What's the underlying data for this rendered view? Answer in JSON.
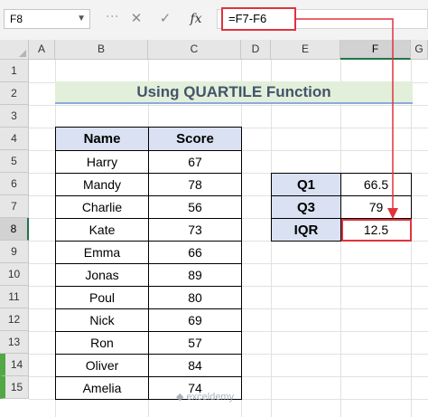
{
  "name_box": "F8",
  "formula": "=F7-F6",
  "columns": [
    "A",
    "B",
    "C",
    "D",
    "E",
    "F",
    "G"
  ],
  "rows": [
    "1",
    "2",
    "3",
    "4",
    "5",
    "6",
    "7",
    "8",
    "9",
    "10",
    "11",
    "12",
    "13",
    "14",
    "15"
  ],
  "title": "Using QUARTILE Function",
  "table": {
    "headers": [
      "Name",
      "Score"
    ],
    "rows": [
      [
        "Harry",
        "67"
      ],
      [
        "Mandy",
        "78"
      ],
      [
        "Charlie",
        "56"
      ],
      [
        "Kate",
        "73"
      ],
      [
        "Emma",
        "66"
      ],
      [
        "Jonas",
        "89"
      ],
      [
        "Poul",
        "80"
      ],
      [
        "Nick",
        "69"
      ],
      [
        "Ron",
        "57"
      ],
      [
        "Oliver",
        "84"
      ],
      [
        "Amelia",
        "74"
      ]
    ]
  },
  "quartiles": [
    {
      "label": "Q1",
      "value": "66.5"
    },
    {
      "label": "Q3",
      "value": "79"
    },
    {
      "label": "IQR",
      "value": "12.5"
    }
  ],
  "icons": {
    "cancel": "✕",
    "confirm": "✓",
    "function": "fx"
  },
  "colors": {
    "highlight": "#e0333c",
    "header_fill": "#d9e1f2",
    "title_fill": "#e2efda"
  }
}
